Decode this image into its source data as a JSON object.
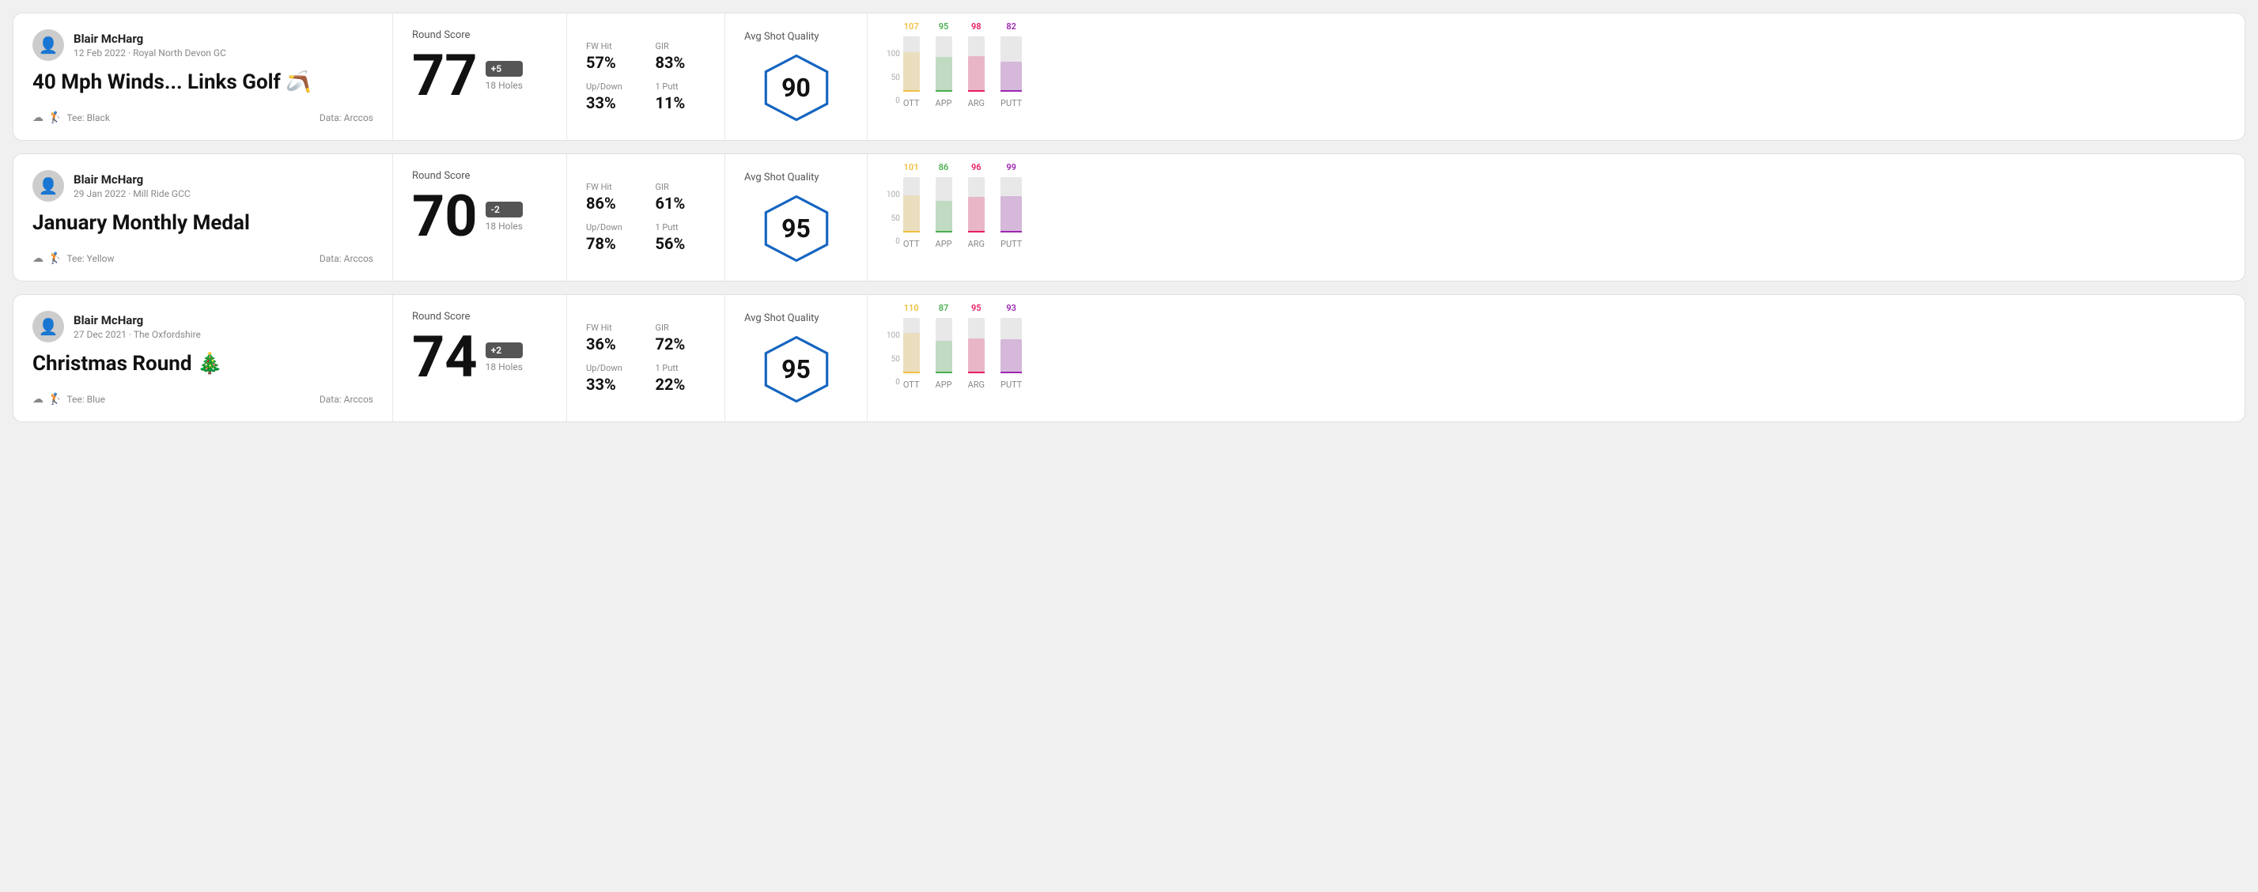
{
  "rounds": [
    {
      "id": "round1",
      "player": {
        "name": "Blair McHarg",
        "date": "12 Feb 2022",
        "course": "Royal North Devon GC"
      },
      "title": "40 Mph Winds... Links Golf 🪃",
      "tee": "Black",
      "data_source": "Data: Arccos",
      "score": {
        "value": "77",
        "modifier": "+5",
        "modifier_type": "positive",
        "holes": "18 Holes"
      },
      "stats": {
        "fw_hit_label": "FW Hit",
        "fw_hit_value": "57%",
        "gir_label": "GIR",
        "gir_value": "83%",
        "updown_label": "Up/Down",
        "updown_value": "33%",
        "oneputt_label": "1 Putt",
        "oneputt_value": "11%"
      },
      "avg_shot_quality": {
        "label": "Avg Shot Quality",
        "value": "90"
      },
      "chart": {
        "bars": [
          {
            "label": "OTT",
            "value": 107,
            "color": "#f0c040",
            "height_pct": 72
          },
          {
            "label": "APP",
            "value": 95,
            "color": "#4caf50",
            "height_pct": 63
          },
          {
            "label": "ARG",
            "value": 98,
            "color": "#e91e63",
            "height_pct": 65
          },
          {
            "label": "PUTT",
            "value": 82,
            "color": "#9c27b0",
            "height_pct": 54
          }
        ],
        "y_max": "100",
        "y_mid": "50",
        "y_min": "0"
      }
    },
    {
      "id": "round2",
      "player": {
        "name": "Blair McHarg",
        "date": "29 Jan 2022",
        "course": "Mill Ride GCC"
      },
      "title": "January Monthly Medal",
      "tee": "Yellow",
      "data_source": "Data: Arccos",
      "score": {
        "value": "70",
        "modifier": "-2",
        "modifier_type": "negative",
        "holes": "18 Holes"
      },
      "stats": {
        "fw_hit_label": "FW Hit",
        "fw_hit_value": "86%",
        "gir_label": "GIR",
        "gir_value": "61%",
        "updown_label": "Up/Down",
        "updown_value": "78%",
        "oneputt_label": "1 Putt",
        "oneputt_value": "56%"
      },
      "avg_shot_quality": {
        "label": "Avg Shot Quality",
        "value": "95"
      },
      "chart": {
        "bars": [
          {
            "label": "OTT",
            "value": 101,
            "color": "#f0c040",
            "height_pct": 67
          },
          {
            "label": "APP",
            "value": 86,
            "color": "#4caf50",
            "height_pct": 57
          },
          {
            "label": "ARG",
            "value": 96,
            "color": "#e91e63",
            "height_pct": 64
          },
          {
            "label": "PUTT",
            "value": 99,
            "color": "#9c27b0",
            "height_pct": 66
          }
        ],
        "y_max": "100",
        "y_mid": "50",
        "y_min": "0"
      }
    },
    {
      "id": "round3",
      "player": {
        "name": "Blair McHarg",
        "date": "27 Dec 2021",
        "course": "The Oxfordshire"
      },
      "title": "Christmas Round 🎄",
      "tee": "Blue",
      "data_source": "Data: Arccos",
      "score": {
        "value": "74",
        "modifier": "+2",
        "modifier_type": "positive",
        "holes": "18 Holes"
      },
      "stats": {
        "fw_hit_label": "FW Hit",
        "fw_hit_value": "36%",
        "gir_label": "GIR",
        "gir_value": "72%",
        "updown_label": "Up/Down",
        "updown_value": "33%",
        "oneputt_label": "1 Putt",
        "oneputt_value": "22%"
      },
      "avg_shot_quality": {
        "label": "Avg Shot Quality",
        "value": "95"
      },
      "chart": {
        "bars": [
          {
            "label": "OTT",
            "value": 110,
            "color": "#f0c040",
            "height_pct": 73
          },
          {
            "label": "APP",
            "value": 87,
            "color": "#4caf50",
            "height_pct": 58
          },
          {
            "label": "ARG",
            "value": 95,
            "color": "#e91e63",
            "height_pct": 63
          },
          {
            "label": "PUTT",
            "value": 93,
            "color": "#9c27b0",
            "height_pct": 62
          }
        ],
        "y_max": "100",
        "y_mid": "50",
        "y_min": "0"
      }
    }
  ]
}
